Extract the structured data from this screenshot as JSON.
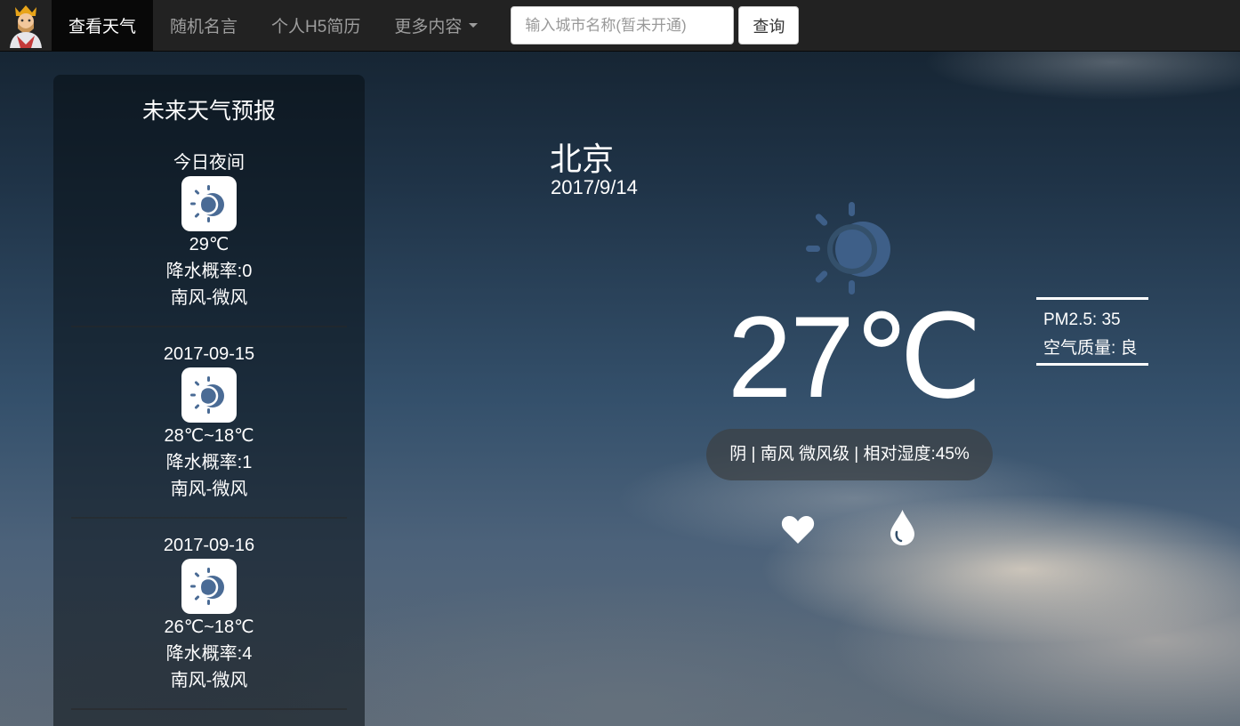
{
  "nav": {
    "items": [
      {
        "label": "查看天气"
      },
      {
        "label": "随机名言"
      },
      {
        "label": "个人H5简历"
      },
      {
        "label": "更多内容"
      }
    ],
    "search_placeholder": "输入城市名称(暂未开通)",
    "search_button": "查询"
  },
  "forecast": {
    "title": "未来天气预报",
    "days": [
      {
        "label": "今日夜间",
        "temp": "29℃",
        "rain": "降水概率:0",
        "wind": "南风-微风",
        "icon": "partly-cloudy-icon"
      },
      {
        "label": "2017-09-15",
        "temp": "28℃~18℃",
        "rain": "降水概率:1",
        "wind": "南风-微风",
        "icon": "partly-cloudy-icon"
      },
      {
        "label": "2017-09-16",
        "temp": "26℃~18℃",
        "rain": "降水概率:4",
        "wind": "南风-微风",
        "icon": "partly-cloudy-icon"
      }
    ]
  },
  "current": {
    "city": "北京",
    "date": "2017/9/14",
    "temp": "27℃",
    "desc": "阴 | 南风 微风级 | 相对湿度:45%",
    "icon": "partly-cloudy-icon"
  },
  "aqi": {
    "pm25": "PM2.5: 35",
    "quality": "空气质量: 良"
  },
  "colors": {
    "navbar": "#222222",
    "icon_blue": "#4a6b95",
    "main_icon": "#3e5f88"
  }
}
